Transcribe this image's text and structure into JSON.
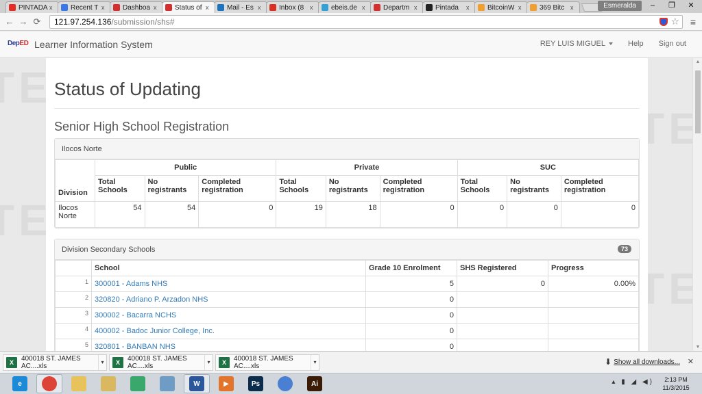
{
  "browser": {
    "tabs": [
      {
        "label": "PINTADA",
        "favicon": "youtube-icon",
        "color": "#e52d27",
        "active": false
      },
      {
        "label": "Recent T",
        "favicon": "chrome-icon",
        "color": "#3b78e7",
        "active": false
      },
      {
        "label": "Dashboa",
        "favicon": "deped-icon",
        "color": "#d32f2f",
        "active": false
      },
      {
        "label": "Status of",
        "favicon": "deped-icon",
        "color": "#d32f2f",
        "active": true
      },
      {
        "label": "Mail - Es",
        "favicon": "mail-icon",
        "color": "#1e73be",
        "active": false
      },
      {
        "label": "Inbox (8",
        "favicon": "gmail-icon",
        "color": "#d93025",
        "active": false
      },
      {
        "label": "ebeis.de",
        "favicon": "ebeis-icon",
        "color": "#33a0d6",
        "active": false
      },
      {
        "label": "Departm",
        "favicon": "deped-icon",
        "color": "#d32f2f",
        "active": false
      },
      {
        "label": "Pintada",
        "favicon": "pintada-icon",
        "color": "#222222",
        "active": false
      },
      {
        "label": "BitcoinW",
        "favicon": "bitcoin-icon",
        "color": "#f0a030",
        "active": false
      },
      {
        "label": "369 Bitc",
        "favicon": "bitcoin-icon",
        "color": "#f0a030",
        "active": false
      }
    ],
    "tab_close": "x",
    "profile_name": "Esmeralda",
    "window_controls": {
      "minimize": "–",
      "restore": "❐",
      "close": "✕"
    },
    "url_host": "121.97.254.136",
    "url_path": "/submission/shs#"
  },
  "navbar": {
    "logo_prefix": "Dep",
    "logo_suffix": "ED",
    "brand": "Learner Information System",
    "user": "REY LUIS MIGUEL",
    "help": "Help",
    "signout": "Sign out"
  },
  "page": {
    "watermark": "TEST",
    "title": "Status of Updating",
    "subtitle": "Senior High School Registration"
  },
  "summary": {
    "panel_title": "Ilocos Norte",
    "division_header": "Division",
    "groups": [
      "Public",
      "Private",
      "SUC"
    ],
    "subheaders": [
      "Total Schools",
      "No registrants",
      "Completed registration"
    ],
    "rows": [
      {
        "division": "Ilocos Norte",
        "values": [
          "54",
          "54",
          "0",
          "19",
          "18",
          "0",
          "0",
          "0",
          "0"
        ]
      }
    ]
  },
  "schools": {
    "panel_title": "Division Secondary Schools",
    "count": "73",
    "headers": [
      "School",
      "Grade 10 Enrolment",
      "SHS Registered",
      "Progress"
    ],
    "rows": [
      {
        "n": "1",
        "school": "300001 - Adams NHS",
        "enrolment": "5",
        "registered": "0",
        "progress": "0.00%"
      },
      {
        "n": "2",
        "school": "320820 - Adriano P. Arzadon NHS",
        "enrolment": "0",
        "registered": "",
        "progress": ""
      },
      {
        "n": "3",
        "school": "300002 - Bacarra NCHS",
        "enrolment": "0",
        "registered": "",
        "progress": ""
      },
      {
        "n": "4",
        "school": "400002 - Badoc Junior College, Inc.",
        "enrolment": "0",
        "registered": "",
        "progress": ""
      },
      {
        "n": "5",
        "school": "320801 - BANBAN NHS",
        "enrolment": "0",
        "registered": "",
        "progress": ""
      }
    ]
  },
  "downloads": {
    "items": [
      {
        "name": "400018 ST. JAMES AC....xls",
        "type": "xls"
      },
      {
        "name": "400018 ST. JAMES AC....xls",
        "type": "xls"
      },
      {
        "name": "400018 ST. JAMES AC....xls",
        "type": "xls"
      }
    ],
    "show_all": "Show all downloads...",
    "close": "✕"
  },
  "taskbar": {
    "apps": [
      {
        "name": "internet-explorer-icon",
        "glyph": "e",
        "color": "#1c8ad6"
      },
      {
        "name": "chrome-icon",
        "glyph": "",
        "color": "#db4437"
      },
      {
        "name": "folder-icon",
        "glyph": "",
        "color": "#e8c25a"
      },
      {
        "name": "file-explorer-icon",
        "glyph": "",
        "color": "#d9b860"
      },
      {
        "name": "atom-icon",
        "glyph": "",
        "color": "#3aa76d"
      },
      {
        "name": "window-icon",
        "glyph": "",
        "color": "#6e9cc4"
      },
      {
        "name": "word-icon",
        "glyph": "W",
        "color": "#2b579a"
      },
      {
        "name": "media-player-icon",
        "glyph": "▶",
        "color": "#e2742b"
      },
      {
        "name": "photoshop-icon",
        "glyph": "Ps",
        "color": "#0b2c4a"
      },
      {
        "name": "circle-app-icon",
        "glyph": "",
        "color": "#4a7fd1"
      },
      {
        "name": "illustrator-icon",
        "glyph": "Ai",
        "color": "#3b1a06"
      }
    ],
    "time": "2:13 PM",
    "date": "11/3/2015"
  }
}
